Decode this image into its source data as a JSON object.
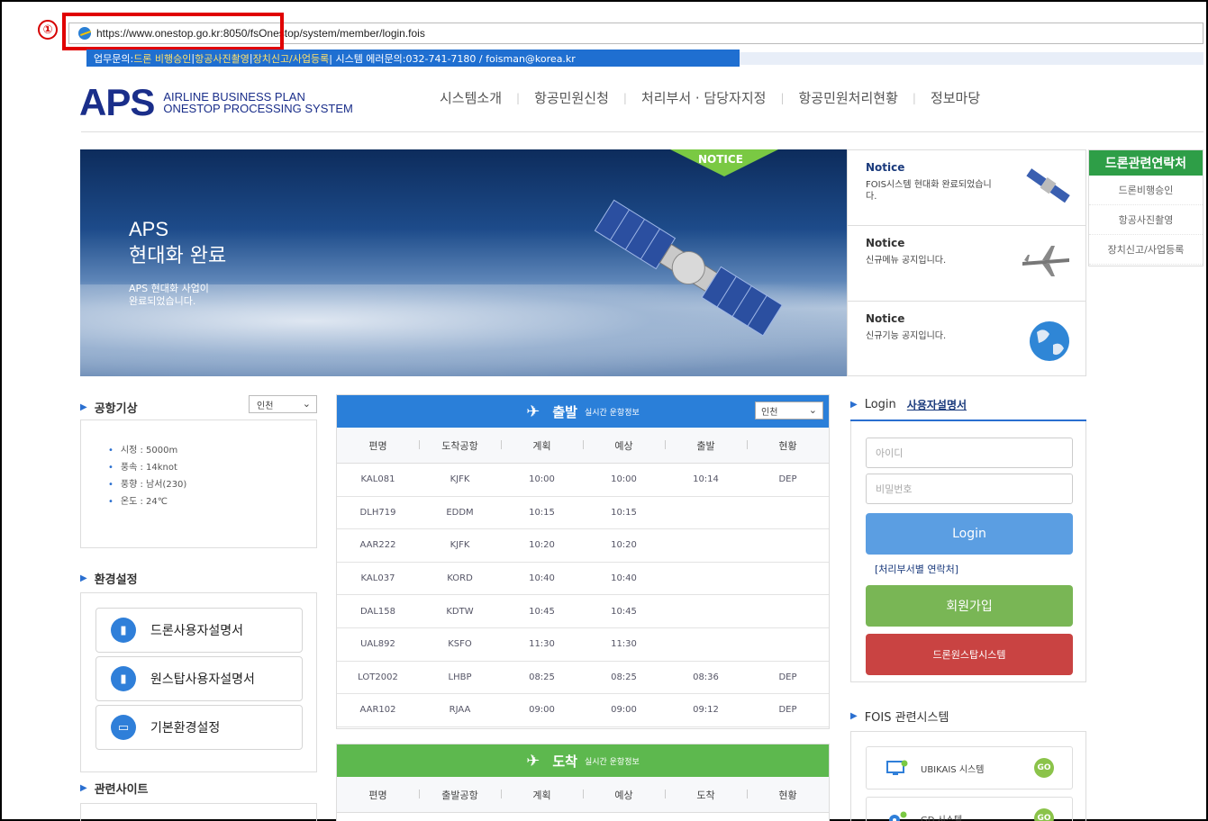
{
  "step_marker": "①",
  "browser": {
    "url": "https://www.onestop.go.kr:8050/fsOnestop/system/member/login.fois"
  },
  "info_strip": {
    "prefix": "업무문의: ",
    "drone_flight": "드론 비행승인",
    "sep1": " | ",
    "aerial_photo": "항공사진촬영",
    "sep2": " | ",
    "device_reg": "장치신고/사업등록",
    "rest": " | 시스템 에러문의:032-741-7180 / foisman@korea.kr"
  },
  "logo": {
    "mark": "APS",
    "line1": "AIRLINE BUSINESS PLAN",
    "line2": "ONESTOP PROCESSING SYSTEM"
  },
  "gnb": [
    "시스템소개",
    "항공민원신청",
    "처리부서 · 담당자지정",
    "항공민원처리현황",
    "정보마당"
  ],
  "banner": {
    "title1": "APS",
    "title2": "현대화 완료",
    "desc1": "APS 현대화 사업이",
    "desc2": "완료되었습니다.",
    "notice_tab": "NOTICE"
  },
  "notices": [
    {
      "heading": "Notice",
      "text": "FOIS시스템 현대화 완료되었습니다."
    },
    {
      "heading": "Notice",
      "text": "신규메뉴 공지입니다."
    },
    {
      "heading": "Notice",
      "text": "신규기능 공지입니다."
    }
  ],
  "side_contact": {
    "title": "드론관련연락처",
    "items": [
      "드론비행승인",
      "항공사진촬영",
      "장치신고/사업등록"
    ]
  },
  "weather": {
    "title": "공항기상",
    "select": "인천",
    "items": [
      "시정 :  5000m",
      "풍속 :  14knot",
      "풍향 :  남서(230)",
      "온도 :  24℃"
    ]
  },
  "env": {
    "title": "환경설정",
    "buttons": [
      "드론사용자설명서",
      "원스탑사용자설명서",
      "기본환경설정"
    ]
  },
  "related_sites": {
    "title": "관련사이트"
  },
  "departure": {
    "label": "출발",
    "sub": "실시간 운항정보",
    "select": "인천",
    "columns": [
      "편명",
      "도착공항",
      "계획",
      "예상",
      "출발",
      "현황"
    ],
    "rows": [
      [
        "KAL081",
        "KJFK",
        "10:00",
        "10:00",
        "10:14",
        "DEP"
      ],
      [
        "DLH719",
        "EDDM",
        "10:15",
        "10:15",
        "",
        ""
      ],
      [
        "AAR222",
        "KJFK",
        "10:20",
        "10:20",
        "",
        ""
      ],
      [
        "KAL037",
        "KORD",
        "10:40",
        "10:40",
        "",
        ""
      ],
      [
        "DAL158",
        "KDTW",
        "10:45",
        "10:45",
        "",
        ""
      ],
      [
        "UAL892",
        "KSFO",
        "11:30",
        "11:30",
        "",
        ""
      ],
      [
        "LOT2002",
        "LHBP",
        "08:25",
        "08:25",
        "08:36",
        "DEP"
      ],
      [
        "AAR102",
        "RJAA",
        "09:00",
        "09:00",
        "09:12",
        "DEP"
      ]
    ]
  },
  "arrival": {
    "label": "도착",
    "sub": "실시간 운항정보",
    "columns": [
      "편명",
      "출발공항",
      "계획",
      "예상",
      "도착",
      "현황"
    ]
  },
  "login": {
    "title": "Login",
    "manual": "사용자설명서",
    "id_placeholder": "아이디",
    "pw_placeholder": "비밀번호",
    "login_button": "Login",
    "contact_link": "[처리부서별 연락처]",
    "join_button": "회원가입",
    "drone_button": "드론원스탑시스템"
  },
  "fois": {
    "title": "FOIS 관련시스템",
    "items": [
      {
        "label": "UBIKAIS 시스템",
        "go": "GO"
      },
      {
        "label": "GD 시스템",
        "go": "GO"
      }
    ]
  },
  "colors": {
    "brand_navy": "#1a2e8a",
    "departure_blue": "#2a7fd9",
    "arrival_green": "#5db84e",
    "login_blue": "#5b9ee2",
    "join_green": "#79b655",
    "drone_red": "#c94342"
  }
}
